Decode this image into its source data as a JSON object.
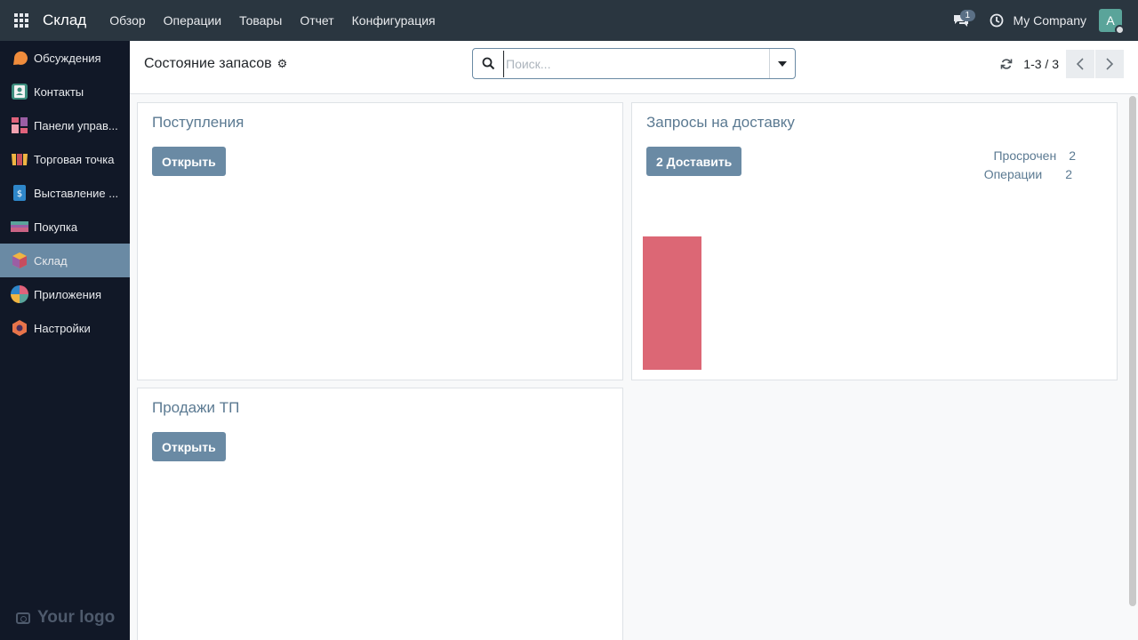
{
  "navbar": {
    "brand": "Склад",
    "menu": [
      "Обзор",
      "Операции",
      "Товары",
      "Отчет",
      "Конфигурация"
    ],
    "chat_count": "1",
    "company": "My Company",
    "avatar_letter": "A"
  },
  "sidebar": {
    "items": [
      {
        "label": "Обсуждения",
        "icon": "discuss-icon"
      },
      {
        "label": "Контакты",
        "icon": "contacts-icon"
      },
      {
        "label": "Панели управ...",
        "icon": "dashboards-icon"
      },
      {
        "label": "Торговая точка",
        "icon": "point-of-sale-icon"
      },
      {
        "label": "Выставление ...",
        "icon": "invoicing-icon"
      },
      {
        "label": "Покупка",
        "icon": "purchase-icon"
      },
      {
        "label": "Склад",
        "icon": "inventory-icon",
        "active": true
      },
      {
        "label": "Приложения",
        "icon": "apps-icon"
      },
      {
        "label": "Настройки",
        "icon": "settings-icon"
      }
    ],
    "logo": "Your logo"
  },
  "control_panel": {
    "title": "Состояние запасов",
    "search_placeholder": "Поиск...",
    "pager": "1-3 / 3"
  },
  "cards": {
    "receipts": {
      "title": "Поступления",
      "button": "Открыть"
    },
    "delivery": {
      "title": "Запросы на доставку",
      "button": "2 Доставить",
      "stats": [
        {
          "label": "Просрочен",
          "value": "2"
        },
        {
          "label": "Операции",
          "value": "2"
        }
      ]
    },
    "pos": {
      "title": "Продажи ТП",
      "button": "Открыть"
    }
  },
  "chart_data": {
    "type": "bar",
    "categories": [
      ""
    ],
    "values": [
      1
    ],
    "ylim": [
      0,
      1
    ],
    "color": "#dc6775"
  },
  "colors": {
    "navbar": "#2a3640",
    "sidebar": "#111827",
    "accent": "#6a8aa4",
    "card_title": "#5b7a92",
    "late_bar": "#dc6775"
  }
}
